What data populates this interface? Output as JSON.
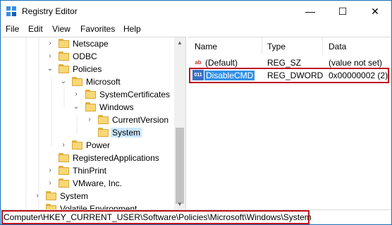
{
  "window": {
    "title": "Registry Editor"
  },
  "caption_buttons": {
    "minimize": "—",
    "maximize": "☐",
    "close": "✕"
  },
  "menu": [
    "File",
    "Edit",
    "View",
    "Favorites",
    "Help"
  ],
  "tree": {
    "nodes": [
      {
        "label": "Netscape",
        "chevron": "›"
      },
      {
        "label": "ODBC",
        "chevron": "›"
      },
      {
        "label": "Policies",
        "chevron": "⌄"
      },
      {
        "label": "Microsoft",
        "chevron": "⌄"
      },
      {
        "label": "SystemCertificates",
        "chevron": "›"
      },
      {
        "label": "Windows",
        "chevron": "⌄"
      },
      {
        "label": "CurrentVersion",
        "chevron": "›"
      },
      {
        "label": "System",
        "chevron": ""
      },
      {
        "label": "Power",
        "chevron": "›"
      },
      {
        "label": "RegisteredApplications",
        "chevron": ""
      },
      {
        "label": "ThinPrint",
        "chevron": "›"
      },
      {
        "label": "VMware, Inc.",
        "chevron": "›"
      },
      {
        "label": "System",
        "chevron": "›"
      },
      {
        "label": "Volatile Environment",
        "chevron": ""
      }
    ],
    "selected": "System"
  },
  "list": {
    "columns": [
      "Name",
      "Type",
      "Data"
    ],
    "rows": [
      {
        "icon": "ab",
        "name": "(Default)",
        "type": "REG_SZ",
        "data": "(value not set)"
      },
      {
        "icon": "011",
        "name": "DisableCMD",
        "type": "REG_DWORD",
        "data": "0x00000002 (2)"
      }
    ]
  },
  "status": {
    "path": "Computer\\HKEY_CURRENT_USER\\Software\\Policies\\Microsoft\\Windows\\System"
  },
  "colors": {
    "highlight": "#c0111a",
    "selection": "#3391e6",
    "tree_selection": "#cce8ff",
    "folder": "#f8d775"
  }
}
